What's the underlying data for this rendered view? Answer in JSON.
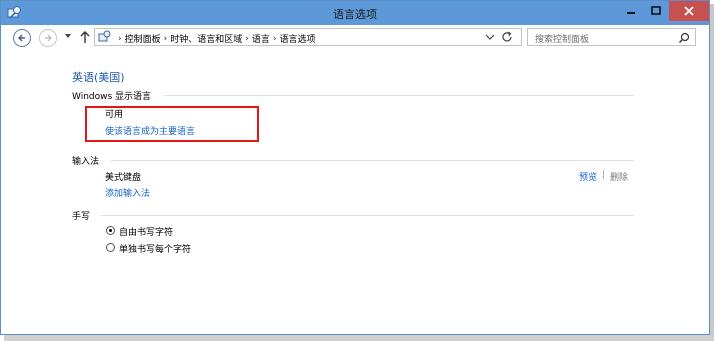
{
  "window": {
    "title": "语言选项"
  },
  "address_bar": {
    "crumbs": [
      "控制面板",
      "时钟、语言和区域",
      "语言",
      "语言选项"
    ],
    "separator": "›"
  },
  "search": {
    "placeholder": "搜索控制面板"
  },
  "content": {
    "language_name": "英语(美国)",
    "display_language": {
      "heading": "Windows 显示语言",
      "status": "可用",
      "make_primary_link": "使该语言成为主要语言"
    },
    "input_method": {
      "heading": "输入法",
      "keyboard_name": "美式键盘",
      "preview_link": "预览",
      "separator": "|",
      "remove_label": "删除",
      "add_link": "添加输入法"
    },
    "handwriting": {
      "heading": "手写",
      "options": [
        {
          "label": "自由书写字符",
          "selected": true
        },
        {
          "label": "单独书写每个字符",
          "selected": false
        }
      ]
    }
  },
  "colors": {
    "titlebar": "#5d99d9",
    "link": "#1664c4",
    "highlight_box": "#e01818",
    "close_button": "#c75050"
  }
}
